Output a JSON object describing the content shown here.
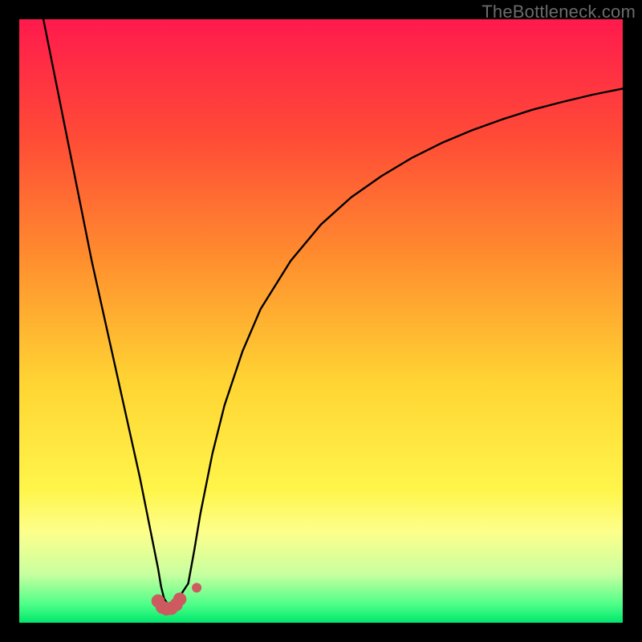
{
  "watermark": "TheBottleneck.com",
  "chart_data": {
    "type": "line",
    "title": "",
    "xlabel": "",
    "ylabel": "",
    "xlim": [
      0,
      100
    ],
    "ylim": [
      0,
      100
    ],
    "grid": false,
    "legend": false,
    "background_gradient": {
      "stops": [
        {
          "pos": 0.0,
          "color": "#ff1a4d"
        },
        {
          "pos": 0.2,
          "color": "#ff4c36"
        },
        {
          "pos": 0.4,
          "color": "#ff8f2e"
        },
        {
          "pos": 0.6,
          "color": "#ffd433"
        },
        {
          "pos": 0.78,
          "color": "#fff54a"
        },
        {
          "pos": 0.85,
          "color": "#fdff8c"
        },
        {
          "pos": 0.92,
          "color": "#c8ffa0"
        },
        {
          "pos": 0.97,
          "color": "#4cff88"
        },
        {
          "pos": 1.0,
          "color": "#00e66b"
        }
      ]
    },
    "series": [
      {
        "name": "left-curve",
        "x": [
          4,
          6,
          8,
          10,
          12,
          14,
          16,
          18,
          20,
          21,
          22,
          23,
          23.5,
          24,
          25,
          25.8,
          26,
          27,
          28
        ],
        "y": [
          100,
          90,
          80,
          70,
          60,
          51,
          42,
          33,
          24,
          19,
          14,
          9,
          6,
          4,
          2.5,
          2.8,
          3.2,
          5,
          6.5
        ]
      },
      {
        "name": "right-curve",
        "x": [
          28,
          29,
          30,
          32,
          34,
          37,
          40,
          45,
          50,
          55,
          60,
          65,
          70,
          75,
          80,
          85,
          90,
          95,
          100
        ],
        "y": [
          6.5,
          12,
          18,
          28,
          36,
          45,
          52,
          60,
          66,
          70.5,
          74,
          77,
          79.5,
          81.6,
          83.4,
          85,
          86.3,
          87.5,
          88.5
        ]
      }
    ],
    "markers": [
      {
        "name": "dot-1",
        "x": 23.0,
        "y": 3.6,
        "r": 1.1,
        "color": "#cc5a5f"
      },
      {
        "name": "dot-2",
        "x": 23.7,
        "y": 2.6,
        "r": 1.1,
        "color": "#cc5a5f"
      },
      {
        "name": "dot-3",
        "x": 24.4,
        "y": 2.3,
        "r": 1.1,
        "color": "#cc5a5f"
      },
      {
        "name": "dot-4",
        "x": 25.2,
        "y": 2.4,
        "r": 1.1,
        "color": "#cc5a5f"
      },
      {
        "name": "dot-5",
        "x": 26.0,
        "y": 3.0,
        "r": 1.1,
        "color": "#cc5a5f"
      },
      {
        "name": "dot-6",
        "x": 26.6,
        "y": 3.9,
        "r": 1.1,
        "color": "#cc5a5f"
      },
      {
        "name": "dot-7",
        "x": 29.4,
        "y": 5.8,
        "r": 0.8,
        "color": "#cc5a5f"
      }
    ]
  }
}
